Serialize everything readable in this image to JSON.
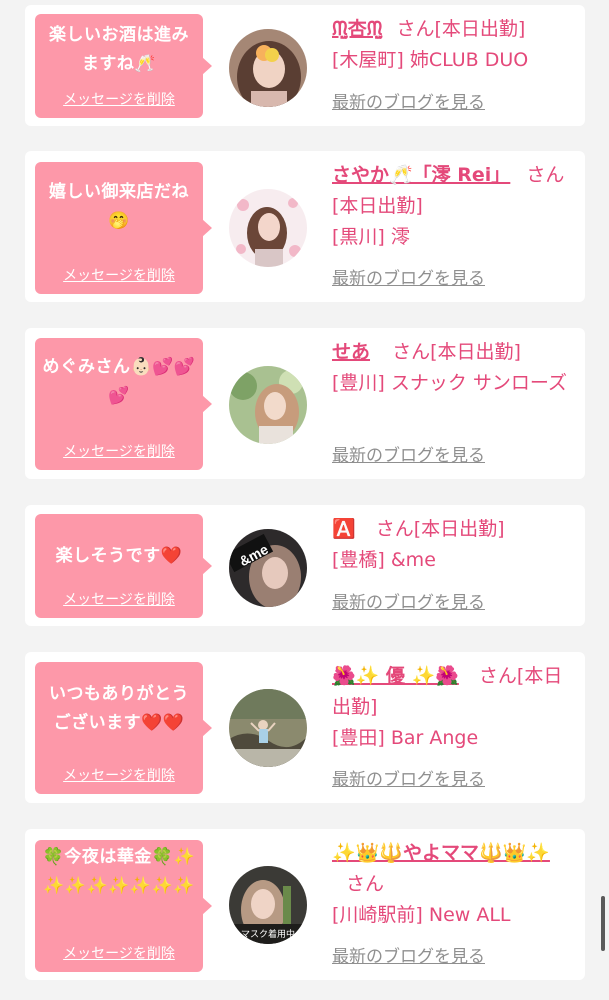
{
  "cards": [
    {
      "message": "楽しいお酒は進みますね🥂",
      "delete_label": "メッセージを削除",
      "name": "ᙏ̤̫杏ᙏ̤̫",
      "san": "さん[本日出勤]",
      "shop": "[木屋町] 姉CLUB DUO",
      "blog_label": "最新のブログを見る"
    },
    {
      "message": "嬉しい御来店だね🤭",
      "delete_label": "メッセージを削除",
      "name": "さやか🥂「澪 Rei」",
      "san": "さん[本日出勤]",
      "shop": "[黒川] 澪",
      "blog_label": "最新のブログを見る"
    },
    {
      "message": "めぐみさん👶🏻💕💕💕",
      "delete_label": "メッセージを削除",
      "name": "せあ",
      "san": "さん[本日出勤]",
      "shop": "[豊川] スナック サンローズ",
      "blog_label": "最新のブログを見る"
    },
    {
      "message": "楽しそうです❤️",
      "delete_label": "メッセージを削除",
      "name": "🅰️",
      "san": "さん[本日出勤]",
      "shop": "[豊橋] &me",
      "blog_label": "最新のブログを見る"
    },
    {
      "message": "いつもありがとうございます❤️❤️",
      "delete_label": "メッセージを削除",
      "name": "🌺✨ 優 ✨🌺",
      "san": "さん[本日出勤]",
      "shop": "[豊田] Bar Ange",
      "blog_label": "最新のブログを見る"
    },
    {
      "message": "🍀今夜は華金🍀✨✨✨✨✨✨✨✨",
      "delete_label": "メッセージを削除",
      "name": "✨👑🔱やよママ🔱👑✨",
      "san": "さん",
      "shop": "[川崎駅前] New ALL",
      "blog_label": "最新のブログを見る"
    }
  ],
  "avatar_badges": {
    "andme": "&me",
    "mask": "マスク着用中"
  },
  "colors": {
    "bubble": "#fd98a9",
    "accent": "#e4497a",
    "link_gray": "#8f8f8f",
    "background": "#f3f3f3"
  }
}
